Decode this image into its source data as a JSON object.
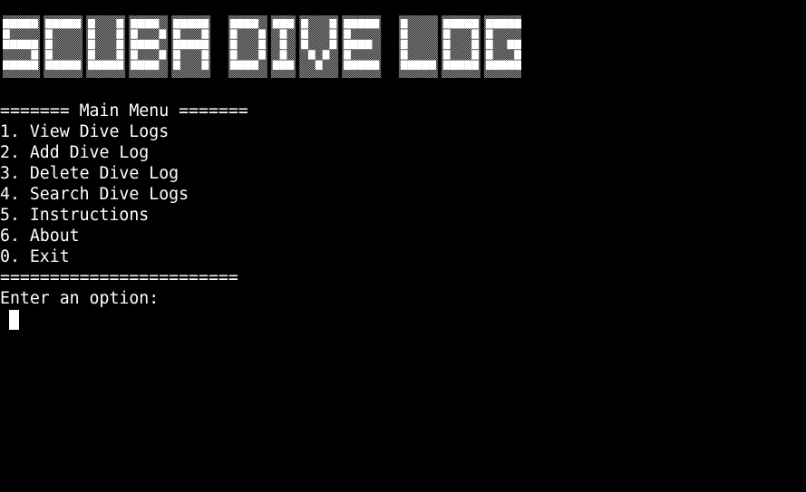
{
  "banner": {
    "text": "SCUBA DIVE LOG"
  },
  "menu": {
    "header": "======= Main Menu =======",
    "items": [
      {
        "label": "1. View Dive Logs"
      },
      {
        "label": "2. Add Dive Log"
      },
      {
        "label": "3. Delete Dive Log"
      },
      {
        "label": "4. Search Dive Logs"
      },
      {
        "label": "5. Instructions"
      },
      {
        "label": "6. About"
      },
      {
        "label": "0. Exit"
      }
    ],
    "footer": "========================"
  },
  "prompt": {
    "text": "Enter an option:"
  },
  "colors": {
    "background": "#000000",
    "foreground": "#ffffff"
  }
}
